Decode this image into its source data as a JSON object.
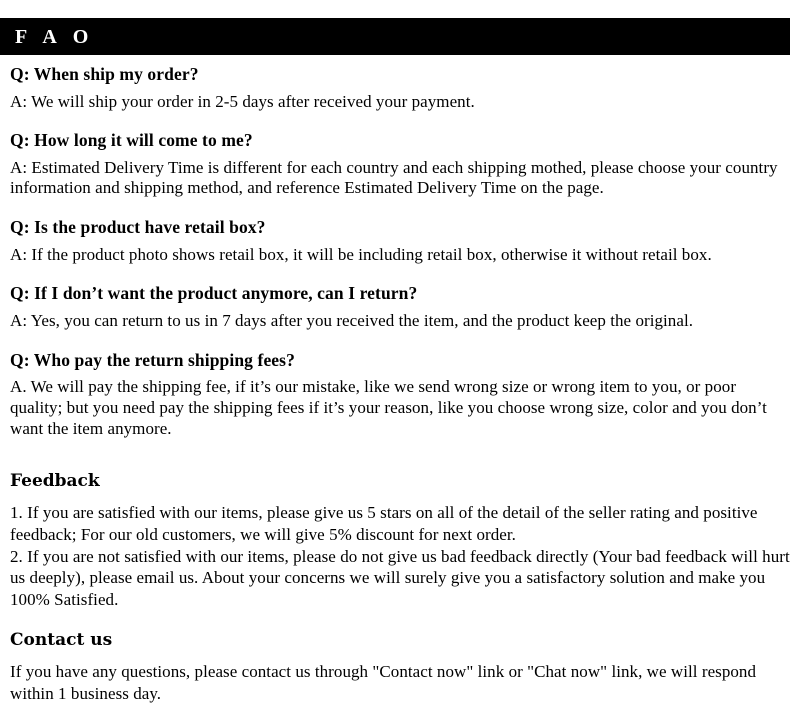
{
  "header": {
    "title": "F A O"
  },
  "faq": {
    "items": [
      {
        "question": "Q: When ship my order?",
        "answer": "A: We will ship your order in 2-5 days after received your payment."
      },
      {
        "question": "Q: How long it will come to me?",
        "answer": "A: Estimated Delivery Time is different for each country and each shipping mothed, please choose your country information and shipping method, and reference Estimated Delivery Time on the page."
      },
      {
        "question": "Q: Is the product have retail box?",
        "answer": "A: If  the product photo shows retail box, it will be including retail box, otherwise it without retail box."
      },
      {
        "question": "Q: If I don’t want the product anymore, can I return?",
        "answer": "A: Yes, you can return to us in 7 days after you received the item, and the product keep the original."
      },
      {
        "question": "Q: Who pay the return shipping fees?",
        "answer": "A. We will pay the shipping fee, if  it’s our mistake, like we send wrong size or wrong item to you, or poor quality; but you need pay the shipping fees if  it’s your reason, like you choose wrong size, color and you don’t want the item anymore."
      }
    ]
  },
  "feedback": {
    "heading": "Feedback",
    "paragraphs": [
      "1.  If you are satisfied with our items, please give us 5 stars on all of the detail of the seller rating and positive feedback; For our old customers, we will give 5% discount for next order.",
      "2.  If you are not satisfied with our items, please do not give us bad feedback directly (Your bad feedback will hurt us deeply), please email us. About your concerns we will surely give you a satisfactory solution and make you 100% Satisfied."
    ]
  },
  "contact": {
    "heading": "Contact us",
    "paragraph": "If you have any questions, please contact us through \"Contact now\" link or \"Chat now\" link, we will respond within 1 business day."
  },
  "colors": {
    "header_background": "#000000",
    "header_text": "#ffffff",
    "body_text": "#000000",
    "page_background": "#ffffff"
  }
}
